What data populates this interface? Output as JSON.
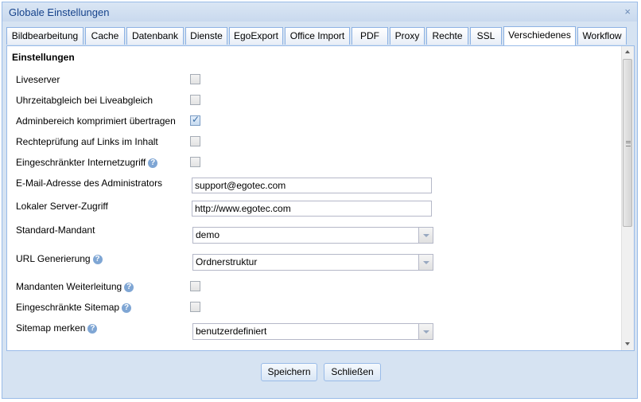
{
  "window": {
    "title": "Globale Einstellungen",
    "close_glyph": "×"
  },
  "tabs": [
    {
      "label": "Bildbearbeitung"
    },
    {
      "label": "Cache"
    },
    {
      "label": "Datenbank"
    },
    {
      "label": "Dienste"
    },
    {
      "label": "EgoExport"
    },
    {
      "label": "Office Import"
    },
    {
      "label": "PDF"
    },
    {
      "label": "Proxy"
    },
    {
      "label": "Rechte"
    },
    {
      "label": "SSL"
    },
    {
      "label": "Verschiedenes"
    },
    {
      "label": "Workflow"
    }
  ],
  "active_tab": "Verschiedenes",
  "section": {
    "title": "Einstellungen"
  },
  "settings": {
    "liveserver": {
      "label": "Liveserver",
      "checked": false
    },
    "uhrzeit": {
      "label": "Uhrzeitabgleich bei Liveabgleich",
      "checked": false
    },
    "admin_komprimiert": {
      "label": "Adminbereich komprimiert übertragen",
      "checked": true
    },
    "rechtepruefung": {
      "label": "Rechteprüfung auf Links im Inhalt",
      "checked": false
    },
    "internetzugriff": {
      "label": "Eingeschränkter Internetzugriff",
      "checked": false
    },
    "admin_email": {
      "label": "E-Mail-Adresse des Administrators",
      "value": "support@egotec.com"
    },
    "server_zugriff": {
      "label": "Lokaler Server-Zugriff",
      "value": "http://www.egotec.com"
    },
    "standard_mandant": {
      "label": "Standard-Mandant",
      "value": "demo"
    },
    "url_generierung": {
      "label": "URL Generierung",
      "value": "Ordnerstruktur"
    },
    "mandanten_weiterleitung": {
      "label": "Mandanten Weiterleitung",
      "checked": false
    },
    "sitemap_eingeschraenkt": {
      "label": "Eingeschränkte Sitemap",
      "checked": false
    },
    "sitemap_merken": {
      "label": "Sitemap merken",
      "value": "benutzerdefiniert"
    }
  },
  "buttons": {
    "save": "Speichern",
    "close": "Schließen"
  },
  "icons": {
    "help": "help-icon",
    "close": "close-icon"
  },
  "colors": {
    "border": "#99bbe8",
    "title": "#15428b"
  }
}
